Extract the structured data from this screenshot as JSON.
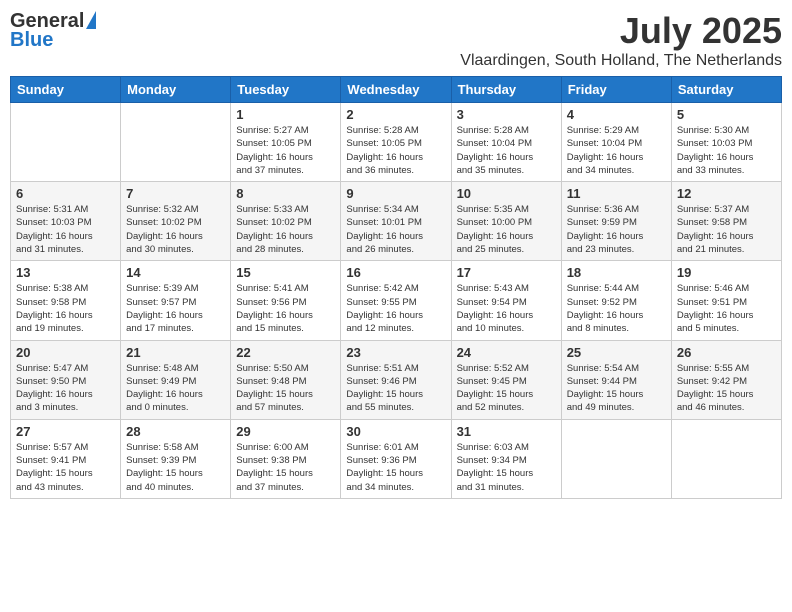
{
  "header": {
    "logo_general": "General",
    "logo_blue": "Blue",
    "month_year": "July 2025",
    "location": "Vlaardingen, South Holland, The Netherlands"
  },
  "days_of_week": [
    "Sunday",
    "Monday",
    "Tuesday",
    "Wednesday",
    "Thursday",
    "Friday",
    "Saturday"
  ],
  "weeks": [
    [
      {
        "day": "",
        "info": ""
      },
      {
        "day": "",
        "info": ""
      },
      {
        "day": "1",
        "info": "Sunrise: 5:27 AM\nSunset: 10:05 PM\nDaylight: 16 hours\nand 37 minutes."
      },
      {
        "day": "2",
        "info": "Sunrise: 5:28 AM\nSunset: 10:05 PM\nDaylight: 16 hours\nand 36 minutes."
      },
      {
        "day": "3",
        "info": "Sunrise: 5:28 AM\nSunset: 10:04 PM\nDaylight: 16 hours\nand 35 minutes."
      },
      {
        "day": "4",
        "info": "Sunrise: 5:29 AM\nSunset: 10:04 PM\nDaylight: 16 hours\nand 34 minutes."
      },
      {
        "day": "5",
        "info": "Sunrise: 5:30 AM\nSunset: 10:03 PM\nDaylight: 16 hours\nand 33 minutes."
      }
    ],
    [
      {
        "day": "6",
        "info": "Sunrise: 5:31 AM\nSunset: 10:03 PM\nDaylight: 16 hours\nand 31 minutes."
      },
      {
        "day": "7",
        "info": "Sunrise: 5:32 AM\nSunset: 10:02 PM\nDaylight: 16 hours\nand 30 minutes."
      },
      {
        "day": "8",
        "info": "Sunrise: 5:33 AM\nSunset: 10:02 PM\nDaylight: 16 hours\nand 28 minutes."
      },
      {
        "day": "9",
        "info": "Sunrise: 5:34 AM\nSunset: 10:01 PM\nDaylight: 16 hours\nand 26 minutes."
      },
      {
        "day": "10",
        "info": "Sunrise: 5:35 AM\nSunset: 10:00 PM\nDaylight: 16 hours\nand 25 minutes."
      },
      {
        "day": "11",
        "info": "Sunrise: 5:36 AM\nSunset: 9:59 PM\nDaylight: 16 hours\nand 23 minutes."
      },
      {
        "day": "12",
        "info": "Sunrise: 5:37 AM\nSunset: 9:58 PM\nDaylight: 16 hours\nand 21 minutes."
      }
    ],
    [
      {
        "day": "13",
        "info": "Sunrise: 5:38 AM\nSunset: 9:58 PM\nDaylight: 16 hours\nand 19 minutes."
      },
      {
        "day": "14",
        "info": "Sunrise: 5:39 AM\nSunset: 9:57 PM\nDaylight: 16 hours\nand 17 minutes."
      },
      {
        "day": "15",
        "info": "Sunrise: 5:41 AM\nSunset: 9:56 PM\nDaylight: 16 hours\nand 15 minutes."
      },
      {
        "day": "16",
        "info": "Sunrise: 5:42 AM\nSunset: 9:55 PM\nDaylight: 16 hours\nand 12 minutes."
      },
      {
        "day": "17",
        "info": "Sunrise: 5:43 AM\nSunset: 9:54 PM\nDaylight: 16 hours\nand 10 minutes."
      },
      {
        "day": "18",
        "info": "Sunrise: 5:44 AM\nSunset: 9:52 PM\nDaylight: 16 hours\nand 8 minutes."
      },
      {
        "day": "19",
        "info": "Sunrise: 5:46 AM\nSunset: 9:51 PM\nDaylight: 16 hours\nand 5 minutes."
      }
    ],
    [
      {
        "day": "20",
        "info": "Sunrise: 5:47 AM\nSunset: 9:50 PM\nDaylight: 16 hours\nand 3 minutes."
      },
      {
        "day": "21",
        "info": "Sunrise: 5:48 AM\nSunset: 9:49 PM\nDaylight: 16 hours\nand 0 minutes."
      },
      {
        "day": "22",
        "info": "Sunrise: 5:50 AM\nSunset: 9:48 PM\nDaylight: 15 hours\nand 57 minutes."
      },
      {
        "day": "23",
        "info": "Sunrise: 5:51 AM\nSunset: 9:46 PM\nDaylight: 15 hours\nand 55 minutes."
      },
      {
        "day": "24",
        "info": "Sunrise: 5:52 AM\nSunset: 9:45 PM\nDaylight: 15 hours\nand 52 minutes."
      },
      {
        "day": "25",
        "info": "Sunrise: 5:54 AM\nSunset: 9:44 PM\nDaylight: 15 hours\nand 49 minutes."
      },
      {
        "day": "26",
        "info": "Sunrise: 5:55 AM\nSunset: 9:42 PM\nDaylight: 15 hours\nand 46 minutes."
      }
    ],
    [
      {
        "day": "27",
        "info": "Sunrise: 5:57 AM\nSunset: 9:41 PM\nDaylight: 15 hours\nand 43 minutes."
      },
      {
        "day": "28",
        "info": "Sunrise: 5:58 AM\nSunset: 9:39 PM\nDaylight: 15 hours\nand 40 minutes."
      },
      {
        "day": "29",
        "info": "Sunrise: 6:00 AM\nSunset: 9:38 PM\nDaylight: 15 hours\nand 37 minutes."
      },
      {
        "day": "30",
        "info": "Sunrise: 6:01 AM\nSunset: 9:36 PM\nDaylight: 15 hours\nand 34 minutes."
      },
      {
        "day": "31",
        "info": "Sunrise: 6:03 AM\nSunset: 9:34 PM\nDaylight: 15 hours\nand 31 minutes."
      },
      {
        "day": "",
        "info": ""
      },
      {
        "day": "",
        "info": ""
      }
    ]
  ]
}
